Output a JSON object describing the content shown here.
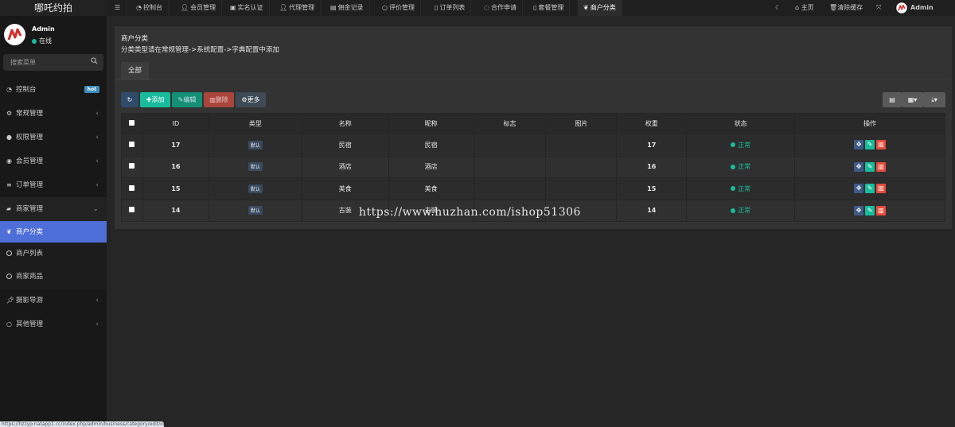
{
  "app": {
    "brand": "哪吒约拍"
  },
  "user": {
    "name": "Admin",
    "status": "在线"
  },
  "sidebar": {
    "search_placeholder": "搜索菜单",
    "items": [
      {
        "label": "控制台",
        "badge": "hot",
        "icon": "dashboard-icon"
      },
      {
        "label": "常规管理",
        "icon": "cogs-icon"
      },
      {
        "label": "权限管理",
        "icon": "group-icon"
      },
      {
        "label": "会员管理",
        "icon": "user-circle-icon"
      },
      {
        "label": "订单管理",
        "icon": "list-icon"
      },
      {
        "label": "商家管理",
        "icon": "shopping-bag-icon"
      },
      {
        "label": "商户分类",
        "icon": "leaf-icon",
        "active": true
      },
      {
        "label": "商户列表",
        "icon": "circle-icon"
      },
      {
        "label": "商家商品",
        "icon": "circle-icon"
      },
      {
        "label": "摄影导游",
        "icon": "thumb-tack-icon"
      },
      {
        "label": "其他管理",
        "icon": "circle-icon"
      }
    ]
  },
  "topbar": {
    "tabs": [
      {
        "label": "控制台",
        "icon": "dashboard-icon"
      },
      {
        "label": "会员管理",
        "icon": "user-icon"
      },
      {
        "label": "实名认证",
        "icon": "id-card-icon"
      },
      {
        "label": "代理管理",
        "icon": "user-icon"
      },
      {
        "label": "佣金记录",
        "icon": "money-icon"
      },
      {
        "label": "评价管理",
        "icon": "circle-icon"
      },
      {
        "label": "订单列表",
        "icon": "file-icon"
      },
      {
        "label": "合作申请",
        "icon": "whatsapp-icon"
      },
      {
        "label": "套餐管理",
        "icon": "file-icon"
      },
      {
        "label": "商户分类",
        "icon": "leaf-icon",
        "active": true
      }
    ],
    "home": "主页",
    "clear_cache": "清除缓存",
    "admin": "Admin"
  },
  "page": {
    "title": "商户分类",
    "subtitle": "分类类型请在常规管理->系统配置->字典配置中添加",
    "tab_all": "全部"
  },
  "toolbar": {
    "add": "添加",
    "edit": "编辑",
    "delete": "删除",
    "more": "更多"
  },
  "table": {
    "headers": [
      "ID",
      "类型",
      "名称",
      "昵称",
      "标志",
      "图片",
      "权重",
      "状态",
      "操作"
    ],
    "rows": [
      {
        "id": "17",
        "type": "默认",
        "name": "民宿",
        "nickname": "民宿",
        "flag": "",
        "image": "",
        "weight": "17",
        "status": "正常"
      },
      {
        "id": "16",
        "type": "默认",
        "name": "酒店",
        "nickname": "酒店",
        "flag": "",
        "image": "",
        "weight": "16",
        "status": "正常"
      },
      {
        "id": "15",
        "type": "默认",
        "name": "美食",
        "nickname": "美食",
        "flag": "",
        "image": "",
        "weight": "15",
        "status": "正常"
      },
      {
        "id": "14",
        "type": "默认",
        "name": "古装",
        "nickname": "古装",
        "flag": "",
        "image": "",
        "weight": "14",
        "status": "正常"
      }
    ]
  },
  "watermark": "https://www.huzhan.com/ishop51306",
  "statusbar": "https://hzzyp.natapp1.cc/index.php/admin/business/category/edit/ids/14",
  "colors": {
    "accent": "#4e6ed8",
    "success": "#18bc9c",
    "danger": "#e74c3c"
  }
}
